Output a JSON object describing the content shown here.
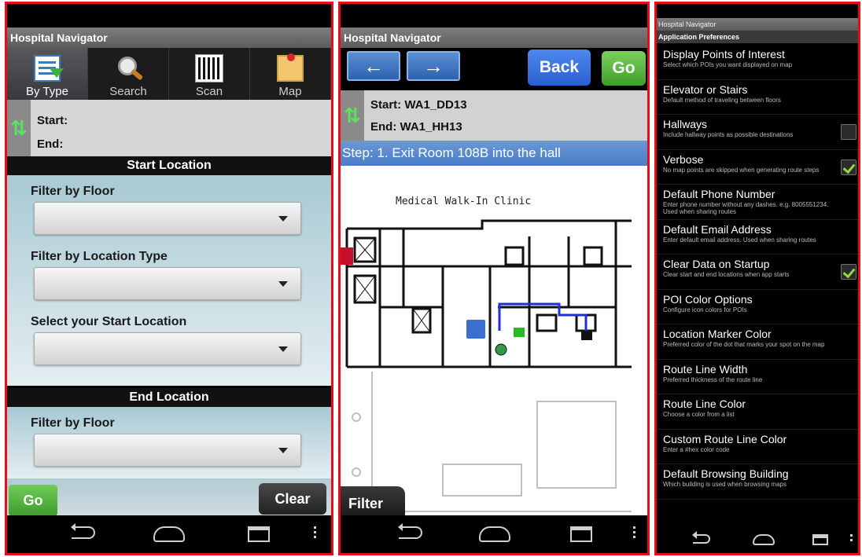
{
  "app": {
    "title": "Hospital Navigator"
  },
  "finder": {
    "tabs": [
      {
        "label": "By Type",
        "icon": "list-download-icon",
        "active": true
      },
      {
        "label": "Search",
        "icon": "magnifier-icon",
        "active": false
      },
      {
        "label": "Scan",
        "icon": "qr-code-icon",
        "active": false
      },
      {
        "label": "Map",
        "icon": "map-pin-icon",
        "active": false
      }
    ],
    "start_label": "Start:",
    "end_label": "End:",
    "start_section": "Start Location",
    "end_section": "End Location",
    "filters": {
      "floor": "Filter by Floor",
      "location_type": "Filter by Location Type",
      "select_start": "Select your Start Location",
      "end_floor": "Filter by Floor"
    },
    "go_label": "Go",
    "clear_label": "Clear"
  },
  "route": {
    "back_label": "Back",
    "go_label": "Go",
    "start": "Start: WA1_DD13",
    "end": "End: WA1_HH13",
    "step": "Step: 1. Exit Room 108B into the hall",
    "map_caption": "Medical Walk-In Clinic",
    "filter_label": "Filter",
    "route_color": "#1d2fd6"
  },
  "prefs": {
    "title": "Hospital Navigator",
    "subtitle": "Application Preferences",
    "items": [
      {
        "title": "Display Points of Interest",
        "sub": "Select which POIs you want displayed on map",
        "checkbox": null
      },
      {
        "title": "Elevator or Stairs",
        "sub": "Default method of traveling between floors",
        "checkbox": null
      },
      {
        "title": "Hallways",
        "sub": "Include hallway points as possible destinations",
        "checkbox": "off"
      },
      {
        "title": "Verbose",
        "sub": "No map points are skipped when generating route steps",
        "checkbox": "on"
      },
      {
        "title": "Default Phone Number",
        "sub": "Enter phone number without any dashes. e.g. 8005551234. Used when sharing routes",
        "checkbox": null
      },
      {
        "title": "Default Email Address",
        "sub": "Enter default email address. Used when sharing routes",
        "checkbox": null
      },
      {
        "title": "Clear Data on Startup",
        "sub": "Clear start and end locations when app starts",
        "checkbox": "on"
      },
      {
        "title": "POI Color Options",
        "sub": "Configure icon colors for POIs",
        "checkbox": null
      },
      {
        "title": "Location Marker Color",
        "sub": "Preferred color of the dot that marks your spot on the map",
        "checkbox": null
      },
      {
        "title": "Route Line Width",
        "sub": "Preferred thickness of the route line",
        "checkbox": null
      },
      {
        "title": "Route Line Color",
        "sub": "Choose a color from a list",
        "checkbox": null
      },
      {
        "title": "Custom Route Line Color",
        "sub": "Enter a #hex color code",
        "checkbox": null
      },
      {
        "title": "Default Browsing Building",
        "sub": "Which building is used when browsing maps",
        "checkbox": null
      }
    ]
  },
  "colors": {
    "frame": "#e3101a",
    "accent_blue": "#4a7cc6",
    "go_green": "#3f9c2c",
    "check_green": "#8cdc3a"
  }
}
